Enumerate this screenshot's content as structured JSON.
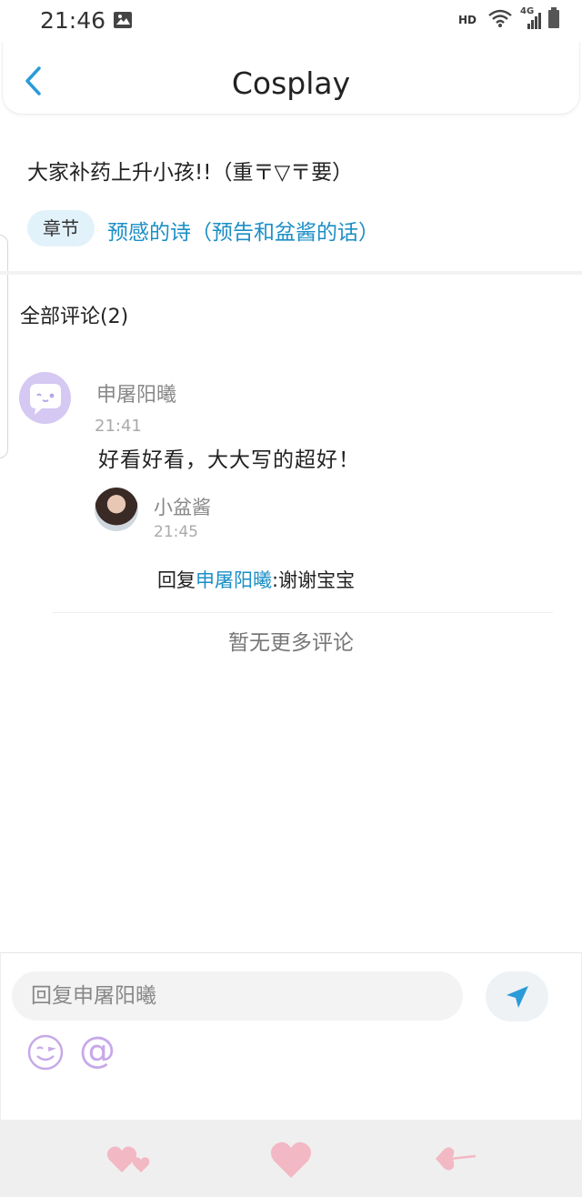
{
  "status_bar": {
    "time": "21:46",
    "hd": "HD",
    "network": "4G"
  },
  "header": {
    "title": "Cosplay"
  },
  "post": {
    "summary": "大家补药上升小孩!!（重〒▽〒要）",
    "chapter_tag": "章节",
    "chapter_title": "预感的诗（预告和盆酱的话）"
  },
  "comments": {
    "section_title": "全部评论(2)",
    "items": [
      {
        "name": "申屠阳曦",
        "time": "21:41",
        "text": "好看好看，大大写的超好！",
        "reply": {
          "name": "小盆酱",
          "time": "21:45",
          "prefix": "回复",
          "mention": "申屠阳曦",
          "text": ":谢谢宝宝"
        }
      }
    ],
    "no_more": "暂无更多评论"
  },
  "composer": {
    "placeholder": "回复申屠阳曦",
    "at_symbol": "@"
  },
  "colors": {
    "accent": "#1b8fc6",
    "icon_purple": "#c7a9e9",
    "heart_pink": "#f2b8c4"
  },
  "bottom_nav": {
    "icons": [
      "double-heart-icon",
      "heart-icon",
      "heart-arrow-icon"
    ]
  }
}
